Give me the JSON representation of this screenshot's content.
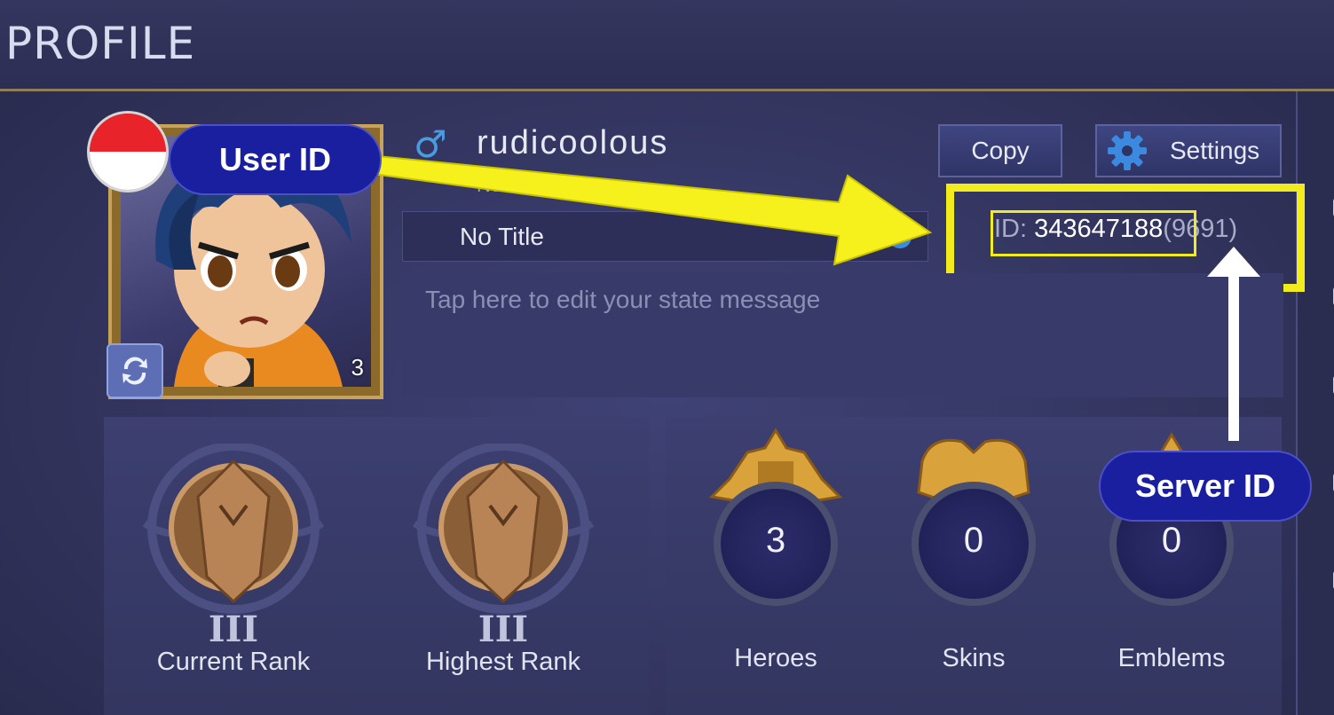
{
  "header": {
    "title": "PROFILE"
  },
  "profile": {
    "gender_symbol": "♂",
    "username": "rudicoolous",
    "subtitle_partial": "No       ved",
    "avatar_level": "3",
    "title_value": "No Title",
    "state_placeholder": "Tap here to edit your state message",
    "id_label": "ID:",
    "user_id": "343647188",
    "server_id": "(9691)"
  },
  "buttons": {
    "copy": "Copy",
    "settings": "Settings"
  },
  "ranks": [
    {
      "tier": "III",
      "label": "Current Rank"
    },
    {
      "tier": "III",
      "label": "Highest Rank"
    }
  ],
  "stats": [
    {
      "value": "3",
      "label": "Heroes"
    },
    {
      "value": "0",
      "label": "Skins"
    },
    {
      "value": "0",
      "label": "Emblems"
    }
  ],
  "annotations": {
    "user_id_label": "User ID",
    "server_id_label": "Server ID",
    "highlight_color": "#f2ec1e",
    "callout_color": "#1a1fa0"
  }
}
